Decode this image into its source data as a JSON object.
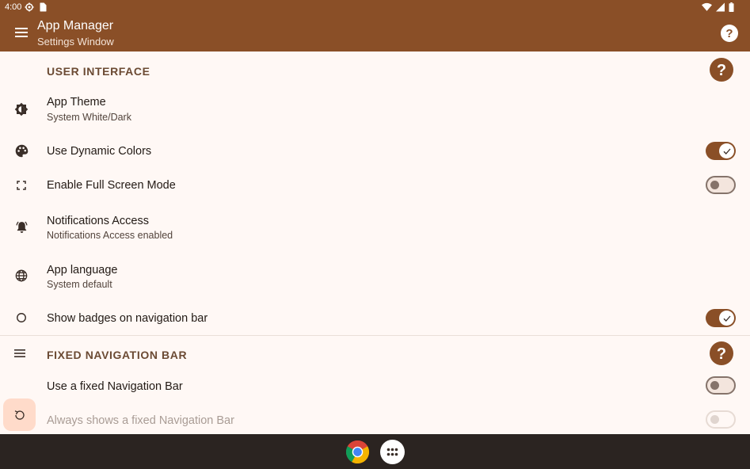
{
  "status_bar": {
    "time": "4:00",
    "left_icons": [
      "settings-icon",
      "sim-card-icon"
    ],
    "right_icons": [
      "wifi-icon",
      "signal-icon",
      "battery-icon"
    ]
  },
  "app_bar": {
    "title": "App Manager",
    "subtitle": "Settings Window",
    "background_color": "#8A4F27"
  },
  "sections": [
    {
      "title": "USER INTERFACE",
      "rows": [
        {
          "icon": "theme-icon",
          "title": "App Theme",
          "subtitle": "System White/Dark"
        },
        {
          "icon": "palette-icon",
          "title": "Use Dynamic Colors",
          "switch": "on"
        },
        {
          "icon": "fullscreen-icon",
          "title": "Enable Full Screen Mode",
          "switch": "off"
        },
        {
          "icon": "notification-bell-icon",
          "title": "Notifications Access",
          "subtitle": "Notifications Access enabled"
        },
        {
          "icon": "globe-icon",
          "title": "App language",
          "subtitle": "System default"
        },
        {
          "icon": "circle-icon",
          "title": "Show badges on navigation bar",
          "switch": "on"
        }
      ]
    },
    {
      "title": "FIXED NAVIGATION BAR",
      "rows": [
        {
          "title": "Use a fixed Navigation Bar",
          "switch": "off"
        },
        {
          "title": "Always shows a fixed Navigation Bar",
          "switch": "disabled"
        }
      ]
    }
  ],
  "taskbar": {
    "apps": [
      "chrome-icon",
      "app-drawer-icon"
    ]
  }
}
